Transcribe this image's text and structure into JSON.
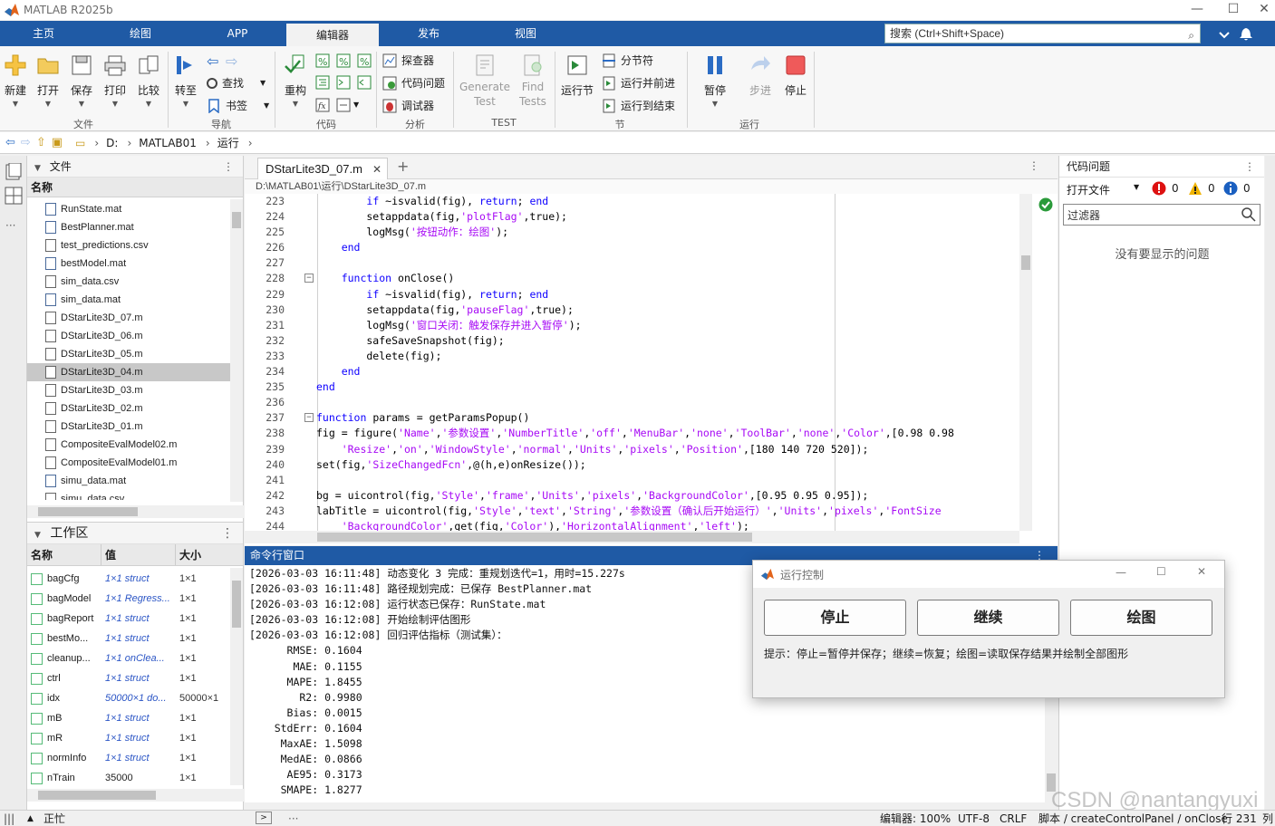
{
  "window": {
    "title": "MATLAB R2025b"
  },
  "tabs": [
    "主页",
    "绘图",
    "APP",
    "编辑器",
    "发布",
    "视图"
  ],
  "search": {
    "placeholder": "搜索 (Ctrl+Shift+Space)"
  },
  "ribbon": {
    "file": {
      "new": "新建",
      "open": "打开",
      "save": "保存",
      "print": "打印",
      "compare": "比较",
      "group": "文件"
    },
    "nav": {
      "goto": "转至",
      "find": "查找",
      "bookmark": "书签",
      "group": "导航"
    },
    "code": {
      "refactor": "重构",
      "group": "代码"
    },
    "analysis": {
      "profiler": "探查器",
      "code_issues": "代码问题",
      "debugger": "调试器",
      "group": "分析"
    },
    "test": {
      "generate_l1": "Generate",
      "generate_l2": "Test",
      "find_l1": "Find",
      "find_l2": "Tests",
      "group": "TEST"
    },
    "section": {
      "run_section": "运行节",
      "break": "分节符",
      "run_advance": "运行并前进",
      "run_to_end": "运行到结束",
      "group": "节"
    },
    "run": {
      "pause": "暂停",
      "step": "步进",
      "stop": "停止",
      "group": "运行"
    }
  },
  "address": {
    "drive": "D:",
    "folder1": "MATLAB01",
    "folder2": "运行"
  },
  "files": {
    "title": "文件",
    "column": "名称",
    "items": [
      "RunState.mat",
      "BestPlanner.mat",
      "test_predictions.csv",
      "bestModel.mat",
      "sim_data.csv",
      "sim_data.mat",
      "DStarLite3D_07.m",
      "DStarLite3D_06.m",
      "DStarLite3D_05.m",
      "DStarLite3D_04.m",
      "DStarLite3D_03.m",
      "DStarLite3D_02.m",
      "DStarLite3D_01.m",
      "CompositeEvalModel02.m",
      "CompositeEvalModel01.m",
      "simu_data.mat",
      "simu_data.csv"
    ],
    "selected_index": 9
  },
  "workspace": {
    "title": "工作区",
    "columns": [
      "名称",
      "值",
      "大小"
    ],
    "rows": [
      {
        "name": "bagCfg",
        "value": "1×1 struct",
        "size": "1×1"
      },
      {
        "name": "bagModel",
        "value": "1×1 Regress...",
        "size": "1×1"
      },
      {
        "name": "bagReport",
        "value": "1×1 struct",
        "size": "1×1"
      },
      {
        "name": "bestMo...",
        "value": "1×1 struct",
        "size": "1×1"
      },
      {
        "name": "cleanup...",
        "value": "1×1 onClea...",
        "size": "1×1"
      },
      {
        "name": "ctrl",
        "value": "1×1 struct",
        "size": "1×1"
      },
      {
        "name": "idx",
        "value": "50000×1 do...",
        "size": "50000×1"
      },
      {
        "name": "mB",
        "value": "1×1 struct",
        "size": "1×1"
      },
      {
        "name": "mR",
        "value": "1×1 struct",
        "size": "1×1"
      },
      {
        "name": "normInfo",
        "value": "1×1 struct",
        "size": "1×1"
      },
      {
        "name": "nTrain",
        "value": "35000",
        "size": "1×1"
      }
    ]
  },
  "editor": {
    "tab": "DStarLite3D_07.m",
    "path": "D:\\MATLAB01\\运行\\DStarLite3D_07.m",
    "lines": [
      {
        "n": "223",
        "fold": false,
        "t": [
          [
            "        ",
            ""
          ],
          [
            "if",
            "kw"
          ],
          [
            " ~isvalid(fig), ",
            ""
          ],
          [
            "return",
            "kw"
          ],
          [
            "; ",
            ""
          ],
          [
            "end",
            "kw"
          ]
        ]
      },
      {
        "n": "224",
        "fold": false,
        "t": [
          [
            "        setappdata(fig,",
            ""
          ],
          [
            "'plotFlag'",
            "st"
          ],
          [
            ",true);",
            ""
          ]
        ]
      },
      {
        "n": "225",
        "fold": false,
        "t": [
          [
            "        logMsg(",
            ""
          ],
          [
            "'按钮动作：绘图'",
            "st"
          ],
          [
            ");",
            ""
          ]
        ]
      },
      {
        "n": "226",
        "fold": false,
        "t": [
          [
            "    ",
            ""
          ],
          [
            "end",
            "kw"
          ]
        ]
      },
      {
        "n": "227",
        "fold": false,
        "t": [
          [
            "",
            ""
          ]
        ]
      },
      {
        "n": "228",
        "fold": true,
        "t": [
          [
            "    ",
            ""
          ],
          [
            "function",
            "kw"
          ],
          [
            " onClose()",
            ""
          ]
        ]
      },
      {
        "n": "229",
        "fold": false,
        "t": [
          [
            "        ",
            ""
          ],
          [
            "if",
            "kw"
          ],
          [
            " ~isvalid(fig), ",
            ""
          ],
          [
            "return",
            "kw"
          ],
          [
            "; ",
            ""
          ],
          [
            "end",
            "kw"
          ]
        ]
      },
      {
        "n": "230",
        "fold": false,
        "t": [
          [
            "        setappdata(fig,",
            ""
          ],
          [
            "'pauseFlag'",
            "st"
          ],
          [
            ",true);",
            ""
          ]
        ]
      },
      {
        "n": "231",
        "fold": false,
        "t": [
          [
            "        logMsg(",
            ""
          ],
          [
            "'窗口关闭：触发保存并进入暂停'",
            "st"
          ],
          [
            ");",
            ""
          ]
        ]
      },
      {
        "n": "232",
        "fold": false,
        "t": [
          [
            "        safeSaveSnapshot(fig);",
            ""
          ]
        ]
      },
      {
        "n": "233",
        "fold": false,
        "t": [
          [
            "        delete(fig);",
            ""
          ]
        ]
      },
      {
        "n": "234",
        "fold": false,
        "t": [
          [
            "    ",
            ""
          ],
          [
            "end",
            "kw"
          ]
        ]
      },
      {
        "n": "235",
        "fold": false,
        "t": [
          [
            "",
            ""
          ],
          [
            "end",
            "kw"
          ]
        ]
      },
      {
        "n": "236",
        "fold": false,
        "t": [
          [
            "",
            ""
          ]
        ]
      },
      {
        "n": "237",
        "fold": true,
        "t": [
          [
            "",
            ""
          ],
          [
            "function",
            "kw"
          ],
          [
            " params = getParamsPopup()",
            ""
          ]
        ]
      },
      {
        "n": "238",
        "fold": false,
        "t": [
          [
            "fig = figure(",
            ""
          ],
          [
            "'Name'",
            "st"
          ],
          [
            ",",
            ""
          ],
          [
            "'参数设置'",
            "st"
          ],
          [
            ",",
            ""
          ],
          [
            "'NumberTitle'",
            "st"
          ],
          [
            ",",
            ""
          ],
          [
            "'off'",
            "st"
          ],
          [
            ",",
            ""
          ],
          [
            "'MenuBar'",
            "st"
          ],
          [
            ",",
            ""
          ],
          [
            "'none'",
            "st"
          ],
          [
            ",",
            ""
          ],
          [
            "'ToolBar'",
            "st"
          ],
          [
            ",",
            ""
          ],
          [
            "'none'",
            "st"
          ],
          [
            ",",
            ""
          ],
          [
            "'Color'",
            "st"
          ],
          [
            ",[0.98 0.98",
            ""
          ]
        ]
      },
      {
        "n": "239",
        "fold": false,
        "t": [
          [
            "    ",
            ""
          ],
          [
            "'Resize'",
            "st"
          ],
          [
            ",",
            ""
          ],
          [
            "'on'",
            "st"
          ],
          [
            ",",
            ""
          ],
          [
            "'WindowStyle'",
            "st"
          ],
          [
            ",",
            ""
          ],
          [
            "'normal'",
            "st"
          ],
          [
            ",",
            ""
          ],
          [
            "'Units'",
            "st"
          ],
          [
            ",",
            ""
          ],
          [
            "'pixels'",
            "st"
          ],
          [
            ",",
            ""
          ],
          [
            "'Position'",
            "st"
          ],
          [
            ",[180 140 720 520]);",
            ""
          ]
        ]
      },
      {
        "n": "240",
        "fold": false,
        "t": [
          [
            "set(fig,",
            ""
          ],
          [
            "'SizeChangedFcn'",
            "st"
          ],
          [
            ",@(h,e)onResize());",
            ""
          ]
        ]
      },
      {
        "n": "241",
        "fold": false,
        "t": [
          [
            "",
            ""
          ]
        ]
      },
      {
        "n": "242",
        "fold": false,
        "t": [
          [
            "bg = uicontrol(fig,",
            ""
          ],
          [
            "'Style'",
            "st"
          ],
          [
            ",",
            ""
          ],
          [
            "'frame'",
            "st"
          ],
          [
            ",",
            ""
          ],
          [
            "'Units'",
            "st"
          ],
          [
            ",",
            ""
          ],
          [
            "'pixels'",
            "st"
          ],
          [
            ",",
            ""
          ],
          [
            "'BackgroundColor'",
            "st"
          ],
          [
            ",[0.95 0.95 0.95]);",
            ""
          ]
        ]
      },
      {
        "n": "243",
        "fold": false,
        "t": [
          [
            "labTitle = uicontrol(fig,",
            ""
          ],
          [
            "'Style'",
            "st"
          ],
          [
            ",",
            ""
          ],
          [
            "'text'",
            "st"
          ],
          [
            ",",
            ""
          ],
          [
            "'String'",
            "st"
          ],
          [
            ",",
            ""
          ],
          [
            "'参数设置（确认后开始运行）'",
            "st"
          ],
          [
            ",",
            ""
          ],
          [
            "'Units'",
            "st"
          ],
          [
            ",",
            ""
          ],
          [
            "'pixels'",
            "st"
          ],
          [
            ",",
            ""
          ],
          [
            "'FontSize",
            "st"
          ]
        ]
      },
      {
        "n": "244",
        "fold": false,
        "t": [
          [
            "    ",
            ""
          ],
          [
            "'BackgroundColor'",
            "st"
          ],
          [
            ",get(fig,",
            ""
          ],
          [
            "'Color'",
            "st"
          ],
          [
            "),",
            ""
          ],
          [
            "'HorizontalAlignment'",
            "st"
          ],
          [
            ",",
            ""
          ],
          [
            "'left'",
            "st"
          ],
          [
            ");",
            ""
          ]
        ]
      }
    ]
  },
  "command": {
    "title": "命令行窗口",
    "lines": [
      "[2026-03-03 16:11:48] 动态变化 3 完成：重规划迭代=1，用时=15.227s",
      "[2026-03-03 16:11:48] 路径规划完成：已保存 BestPlanner.mat",
      "[2026-03-03 16:12:08] 运行状态已保存：RunState.mat",
      "[2026-03-03 16:12:08] 开始绘制评估图形",
      "[2026-03-03 16:12:08] 回归评估指标（测试集）：",
      "      RMSE: 0.1604",
      "       MAE: 0.1155",
      "      MAPE: 1.8455",
      "        R2: 0.9980",
      "      Bias: 0.0015",
      "    StdErr: 0.1604",
      "     MaxAE: 1.5098",
      "     MedAE: 0.0866",
      "      AE95: 0.3173",
      "     SMAPE: 1.8277"
    ]
  },
  "issues": {
    "title": "代码问题",
    "scope": "打开文件",
    "errors": "0",
    "warnings": "0",
    "infos": "0",
    "filter_placeholder": "过滤器",
    "empty": "没有要显示的问题"
  },
  "dialog": {
    "title": "运行控制",
    "stop": "停止",
    "resume": "继续",
    "plot": "绘图",
    "hint": "提示：停止=暂停并保存；继续=恢复；绘图=读取保存结果并绘制全部图形"
  },
  "status": {
    "state": "正忙",
    "editor": "编辑器: 100%",
    "encoding": "UTF-8",
    "eol": "CRLF",
    "script": "脚本 / createControlPanel / onClose",
    "line": "行 231",
    "col": "列"
  },
  "watermark": "CSDN @nantangyuxi",
  "colors": {
    "accent": "#1f5aa5",
    "keyword": "#0e00ff",
    "string": "#a709f5"
  }
}
